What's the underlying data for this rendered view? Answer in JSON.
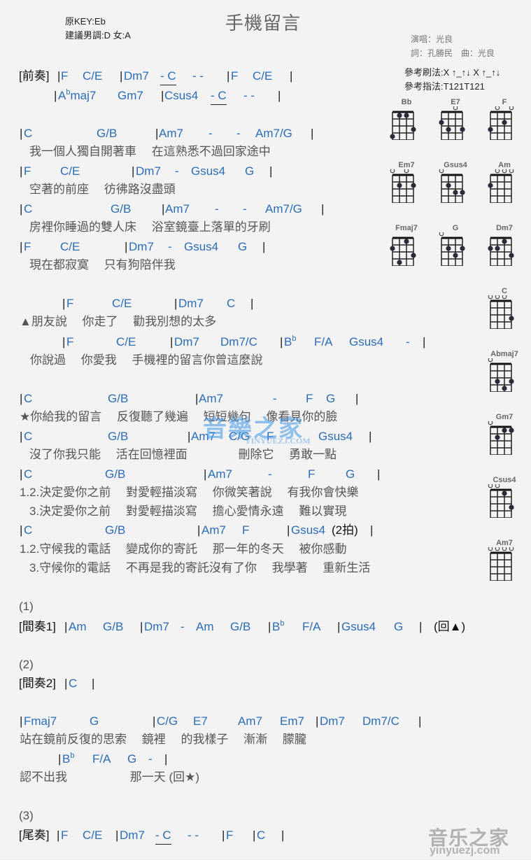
{
  "header": {
    "title": "手機留言",
    "original_key": "原KEY:Eb",
    "suggested_key": "建議男調:D 女:A",
    "singer": "演唱：光良",
    "credits": "詞：孔勝民　曲：光良",
    "strum": "參考刷法:X ↑_↑↓ X ↑_↑↓",
    "finger": "參考指法:T121T121"
  },
  "sections": {
    "prelude_label": "[前奏]",
    "interlude1_num": "(1)",
    "interlude1_label": "[間奏1]",
    "interlude2_num": "(2)",
    "interlude2_label": "[間奏2]",
    "outro_num": "(3)",
    "outro_label": "[尾奏]"
  },
  "lines": {
    "l1": [
      "|",
      "F",
      "C/E",
      "|",
      "Dm7",
      "-  C",
      "-  -",
      "|",
      "F",
      "C/E",
      "|"
    ],
    "l2": [
      "|",
      "A",
      "b",
      "maj7",
      "Gm7",
      "|",
      "Csus4",
      "-  C",
      "-  -",
      "|"
    ],
    "l3": [
      "|",
      "C",
      "G/B",
      "|",
      "Am7",
      "-",
      "-",
      "Am7/G",
      "|"
    ],
    "y3": "我一個人獨自開著車　 在這熟悉不過回家途中",
    "l4": [
      "|",
      "F",
      "C/E",
      "|",
      "Dm7",
      "-",
      "Gsus4",
      "G",
      "|"
    ],
    "y4": "空著的前座　 彷彿路沒盡頭",
    "l5": [
      "|",
      "C",
      "G/B",
      "|",
      "Am7",
      "-",
      "-",
      "Am7/G",
      "|"
    ],
    "y5": "房裡你睡過的雙人床　 浴室鏡臺上落單的牙刷",
    "l6": [
      "|",
      "F",
      "C/E",
      "|",
      "Dm7",
      "-",
      "Gsus4",
      "G",
      "|"
    ],
    "y6": "現在都寂寞　 只有狗陪伴我",
    "l7": [
      "|",
      "F",
      "C/E",
      "|",
      "Dm7",
      "C",
      "|"
    ],
    "y7": "▲朋友說　 你走了　 勸我別想的太多",
    "l8": [
      "|",
      "F",
      "C/E",
      "|",
      "Dm7",
      "Dm7/C",
      "|",
      "B",
      "b",
      "F/A",
      "Gsus4",
      "-",
      "|"
    ],
    "y8": "你說過　 你愛我　 手機裡的留言你曾這麼說",
    "l9": [
      "|",
      "C",
      "G/B",
      "|",
      "Am7",
      "-",
      "F",
      "G",
      "|"
    ],
    "y9": "★你給我的留言　 反復聽了幾遍　 短短幾句　 像看見你的臉",
    "l10": [
      "|",
      "C",
      "G/B",
      "|",
      "Am7",
      "C/G",
      "F",
      "Gsus4",
      "|"
    ],
    "y10": "沒了你我只能　 活在回憶裡面　　　　 刪除它　 勇敢一點",
    "l11": [
      "|",
      "C",
      "G/B",
      "|",
      "Am7",
      "-",
      "F",
      "G",
      "|"
    ],
    "y11a": "1.2.決定愛你之前　 對愛輕描淡寫　 你微笑著說　 有我你會快樂",
    "y11b": "3.決定愛你之前　 對愛輕描淡寫　 擔心愛情永遠　 難以實現",
    "l12": [
      "|",
      "C",
      "G/B",
      "|",
      "Am7",
      "F",
      "|",
      "Gsus4",
      "(2拍)",
      "|"
    ],
    "y12a": "1.2.守候我的電話　 變成你的寄託　 那一年的冬天　 被你感動",
    "y12b": "3.守候你的電話　 不再是我的寄託沒有了你　 我學著　 重新生活",
    "l13": [
      "|",
      "Am",
      "G/B",
      "|",
      "Dm7",
      "-",
      "Am",
      "G/B",
      "|",
      "B",
      "b",
      "F/A",
      "|",
      "Gsus4",
      "G",
      "|",
      "(回▲)"
    ],
    "l14": [
      "|",
      "C",
      "|"
    ],
    "l15": [
      "|",
      "Fmaj7",
      "G",
      "|",
      "C/G",
      "E7",
      "Am7",
      "Em7",
      "|",
      "Dm7",
      "Dm7/C",
      "|"
    ],
    "y15": "站在鏡前反復的思索　 鏡裡　 的我樣子　 漸漸　 朦朧",
    "l16": [
      "|",
      "B",
      "b",
      "F/A",
      "G",
      "-",
      "|"
    ],
    "y16": "認不出我　　　　　 那一天 (回★)",
    "l17": [
      "|",
      "F",
      "C/E",
      "|",
      "Dm7",
      "-  C",
      "-  -",
      "|",
      "F",
      "|",
      "C",
      "|"
    ]
  },
  "chord_diagrams": [
    {
      "name": "Bb",
      "open": [],
      "dots": [
        [
          1,
          4
        ],
        [
          2,
          1
        ],
        [
          3,
          1
        ],
        [
          4,
          3
        ]
      ]
    },
    {
      "name": "E7",
      "open": [
        3
      ],
      "dots": [
        [
          1,
          2
        ],
        [
          2,
          3
        ],
        [
          4,
          3
        ]
      ]
    },
    {
      "name": "F",
      "open": [
        2,
        4
      ],
      "dots": [
        [
          1,
          3
        ],
        [
          3,
          2
        ]
      ]
    },
    {
      "name": "Em7",
      "open": [
        1,
        3
      ],
      "dots": [
        [
          2,
          2
        ],
        [
          4,
          2
        ]
      ]
    },
    {
      "name": "Gsus4",
      "open": [
        1
      ],
      "dots": [
        [
          2,
          2
        ],
        [
          3,
          3
        ],
        [
          4,
          3
        ]
      ]
    },
    {
      "name": "Am",
      "open": [
        2,
        3,
        4
      ],
      "dots": [
        [
          1,
          2
        ]
      ]
    },
    {
      "name": "Fmaj7",
      "open": [],
      "dots": [
        [
          1,
          2
        ],
        [
          2,
          4
        ],
        [
          3,
          1
        ],
        [
          4,
          3
        ]
      ]
    },
    {
      "name": "G",
      "open": [
        1
      ],
      "dots": [
        [
          2,
          2
        ],
        [
          3,
          3
        ],
        [
          4,
          2
        ]
      ]
    },
    {
      "name": "Dm7",
      "open": [],
      "dots": [
        [
          1,
          2
        ],
        [
          2,
          2
        ],
        [
          3,
          1
        ],
        [
          4,
          3
        ]
      ]
    },
    {
      "name": "C",
      "open": [
        1,
        2,
        3
      ],
      "dots": [
        [
          4,
          3
        ]
      ]
    },
    {
      "name": "Abmaj7",
      "open": [
        1
      ],
      "dots": [
        [
          2,
          3
        ],
        [
          3,
          4
        ],
        [
          4,
          3
        ]
      ]
    },
    {
      "name": "Gm7",
      "open": [
        1
      ],
      "dots": [
        [
          2,
          2
        ],
        [
          3,
          1
        ],
        [
          4,
          1
        ]
      ]
    },
    {
      "name": "Csus4",
      "open": [
        1,
        2
      ],
      "dots": [
        [
          3,
          1
        ],
        [
          4,
          3
        ]
      ]
    },
    {
      "name": "Am7",
      "open": [
        1,
        2,
        3,
        4
      ],
      "dots": []
    }
  ],
  "watermarks": {
    "center_cn": "音樂之家",
    "center_en": "YINYUEZJ.COM",
    "corner_cn": "音乐之家",
    "corner_en": "yinyuezj.com"
  }
}
